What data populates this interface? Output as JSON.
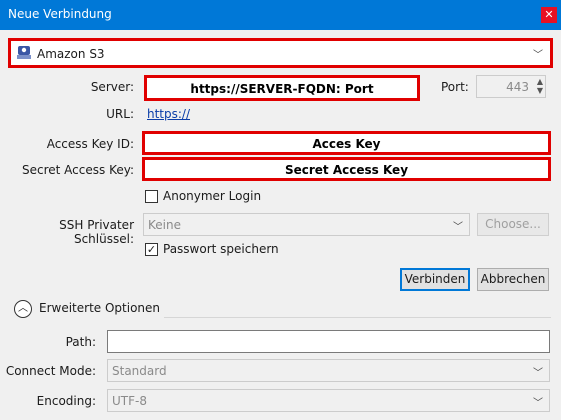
{
  "window": {
    "title": "Neue Verbindung",
    "close_icon": "close-icon"
  },
  "protocol": {
    "value": "Amazon S3",
    "icon": "s3-icon"
  },
  "server": {
    "label": "Server:",
    "value": "https://SERVER-FQDN: Port"
  },
  "port": {
    "label": "Port:",
    "value": "443"
  },
  "url": {
    "label": "URL:",
    "value": "https://"
  },
  "access_key": {
    "label": "Access Key ID:",
    "value": "Acces Key"
  },
  "secret_key": {
    "label": "Secret Access Key:",
    "value": "Secret Access Key"
  },
  "anonymous": {
    "label": "Anonymer Login",
    "checked": false
  },
  "ssh_key": {
    "label": "SSH Privater Schlüssel:",
    "value": "Keine",
    "choose_label": "Choose..."
  },
  "save_password": {
    "label": "Passwort speichern",
    "checked": true
  },
  "buttons": {
    "connect": "Verbinden",
    "cancel": "Abbrechen"
  },
  "advanced": {
    "label": "Erweiterte Optionen"
  },
  "path": {
    "label": "Path:",
    "value": ""
  },
  "connect_mode": {
    "label": "Connect Mode:",
    "value": "Standard"
  },
  "encoding": {
    "label": "Encoding:",
    "value": "UTF-8"
  },
  "colors": {
    "titlebar": "#0078d7",
    "highlight": "#e00000",
    "close": "#e81123"
  }
}
